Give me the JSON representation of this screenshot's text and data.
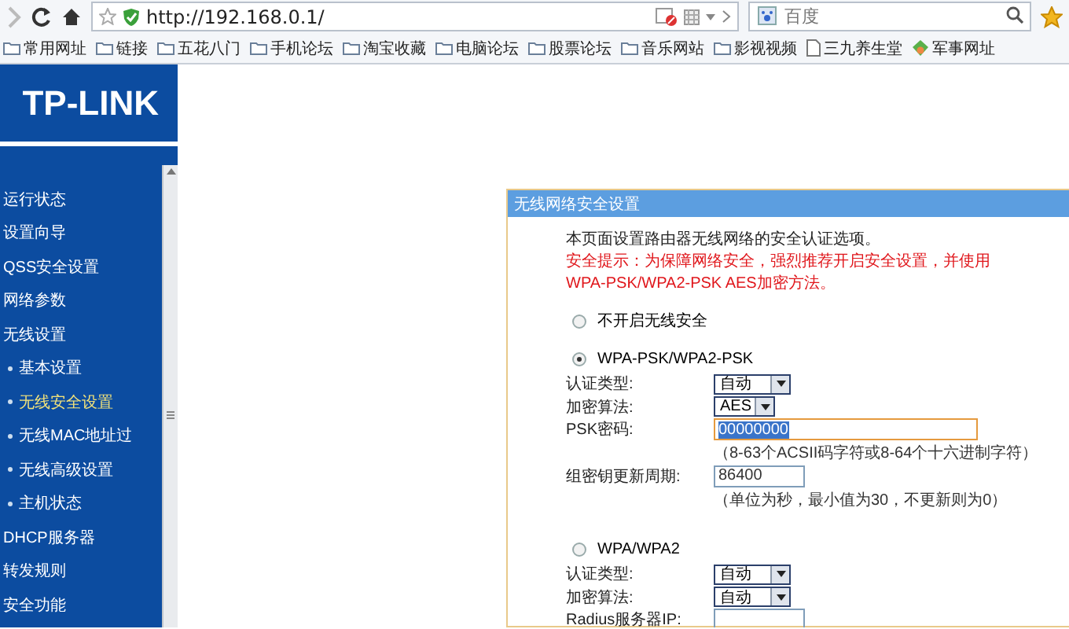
{
  "browser": {
    "url": "http://192.168.0.1/",
    "search": {
      "placeholder": "百度"
    },
    "bookmarks": [
      {
        "label": "常用网址",
        "kind": "folder"
      },
      {
        "label": "链接",
        "kind": "folder"
      },
      {
        "label": "五花八门",
        "kind": "folder"
      },
      {
        "label": "手机论坛",
        "kind": "folder"
      },
      {
        "label": "淘宝收藏",
        "kind": "folder"
      },
      {
        "label": "电脑论坛",
        "kind": "folder"
      },
      {
        "label": "股票论坛",
        "kind": "folder"
      },
      {
        "label": "音乐网站",
        "kind": "folder"
      },
      {
        "label": "影视视频",
        "kind": "folder"
      },
      {
        "label": "三九养生堂",
        "kind": "page"
      },
      {
        "label": "军事网址",
        "kind": "site"
      }
    ]
  },
  "logo": "TP-LINK",
  "sidebar": {
    "items": [
      {
        "label": "运行状态",
        "selected": false
      },
      {
        "label": "设置向导",
        "selected": false
      },
      {
        "label": "QSS安全设置",
        "selected": false
      },
      {
        "label": "网络参数",
        "selected": false
      },
      {
        "label": "无线设置",
        "selected": false,
        "children": [
          {
            "label": "基本设置",
            "selected": false
          },
          {
            "label": "无线安全设置",
            "selected": true
          },
          {
            "label": "无线MAC地址过",
            "selected": false
          },
          {
            "label": "无线高级设置",
            "selected": false
          },
          {
            "label": "主机状态",
            "selected": false
          }
        ]
      },
      {
        "label": "DHCP服务器",
        "selected": false
      },
      {
        "label": "转发规则",
        "selected": false
      },
      {
        "label": "安全功能",
        "selected": false
      }
    ]
  },
  "panel": {
    "title": "无线网络安全设置",
    "intro": "本页面设置路由器无线网络的安全认证选项。",
    "warning": "安全提示：为保障网络安全，强烈推荐开启安全设置，并使用WPA-PSK/WPA2-PSK AES加密方法。",
    "options": [
      {
        "label": "不开启无线安全",
        "selected": false
      },
      {
        "label": "WPA-PSK/WPA2-PSK",
        "selected": true,
        "fields": [
          {
            "label": "认证类型:",
            "kind": "select",
            "value": "自动"
          },
          {
            "label": "加密算法:",
            "kind": "select",
            "value": "AES"
          },
          {
            "label": "PSK密码:",
            "kind": "input",
            "value": "00000000",
            "focused": true,
            "hint": "（8-63个ACSII码字符或8-64个十六进制字符）"
          },
          {
            "label": "组密钥更新周期:",
            "kind": "input",
            "value": "86400",
            "focused": false,
            "hint": "（单位为秒，最小值为30，不更新则为0）"
          }
        ]
      },
      {
        "label": "WPA/WPA2",
        "selected": false,
        "fields": [
          {
            "label": "认证类型:",
            "kind": "select",
            "value": "自动"
          },
          {
            "label": "加密算法:",
            "kind": "select",
            "value": "自动"
          },
          {
            "label": "Radius服务器IP:",
            "kind": "input",
            "focused": false
          }
        ]
      }
    ]
  }
}
